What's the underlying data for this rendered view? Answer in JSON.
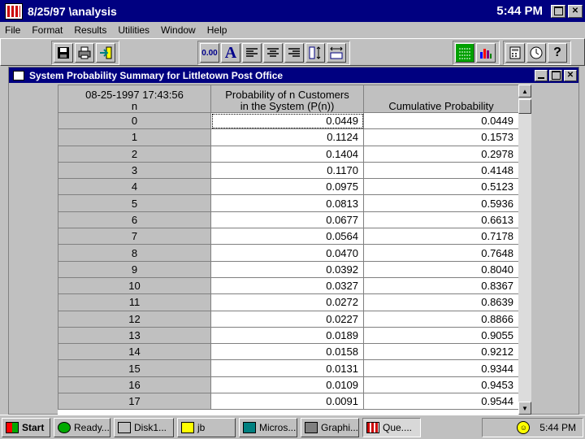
{
  "app": {
    "title": "8/25/97 \\analysis",
    "clock": "5:44 PM"
  },
  "menu": [
    "File",
    "Format",
    "Results",
    "Utilities",
    "Window",
    "Help"
  ],
  "toolbar": {
    "decimal_label": "0.00",
    "font_label": "A"
  },
  "child": {
    "title": "System Probability Summary for Littletown Post Office"
  },
  "table": {
    "headers": {
      "n_line1": "08-25-1997  17:43:56",
      "n_line2": "n",
      "prob_line1": "Probability of n Customers",
      "prob_line2": "in the System (P(n))",
      "cum": "Cumulative Probability"
    },
    "rows": [
      {
        "n": "0",
        "p": "0.0449",
        "c": "0.0449"
      },
      {
        "n": "1",
        "p": "0.1124",
        "c": "0.1573"
      },
      {
        "n": "2",
        "p": "0.1404",
        "c": "0.2978"
      },
      {
        "n": "3",
        "p": "0.1170",
        "c": "0.4148"
      },
      {
        "n": "4",
        "p": "0.0975",
        "c": "0.5123"
      },
      {
        "n": "5",
        "p": "0.0813",
        "c": "0.5936"
      },
      {
        "n": "6",
        "p": "0.0677",
        "c": "0.6613"
      },
      {
        "n": "7",
        "p": "0.0564",
        "c": "0.7178"
      },
      {
        "n": "8",
        "p": "0.0470",
        "c": "0.7648"
      },
      {
        "n": "9",
        "p": "0.0392",
        "c": "0.8040"
      },
      {
        "n": "10",
        "p": "0.0327",
        "c": "0.8367"
      },
      {
        "n": "11",
        "p": "0.0272",
        "c": "0.8639"
      },
      {
        "n": "12",
        "p": "0.0227",
        "c": "0.8866"
      },
      {
        "n": "13",
        "p": "0.0189",
        "c": "0.9055"
      },
      {
        "n": "14",
        "p": "0.0158",
        "c": "0.9212"
      },
      {
        "n": "15",
        "p": "0.0131",
        "c": "0.9344"
      },
      {
        "n": "16",
        "p": "0.0109",
        "c": "0.9453"
      },
      {
        "n": "17",
        "p": "0.0091",
        "c": "0.9544"
      }
    ]
  },
  "taskbar": {
    "start": "Start",
    "tasks": [
      "Ready...",
      "Disk1...",
      "jb",
      "Micros...",
      "Graphi...",
      "Que...."
    ],
    "clock": "5:44 PM"
  },
  "colors": {
    "titlebar": "#000080",
    "face": "#c0c0c0"
  }
}
